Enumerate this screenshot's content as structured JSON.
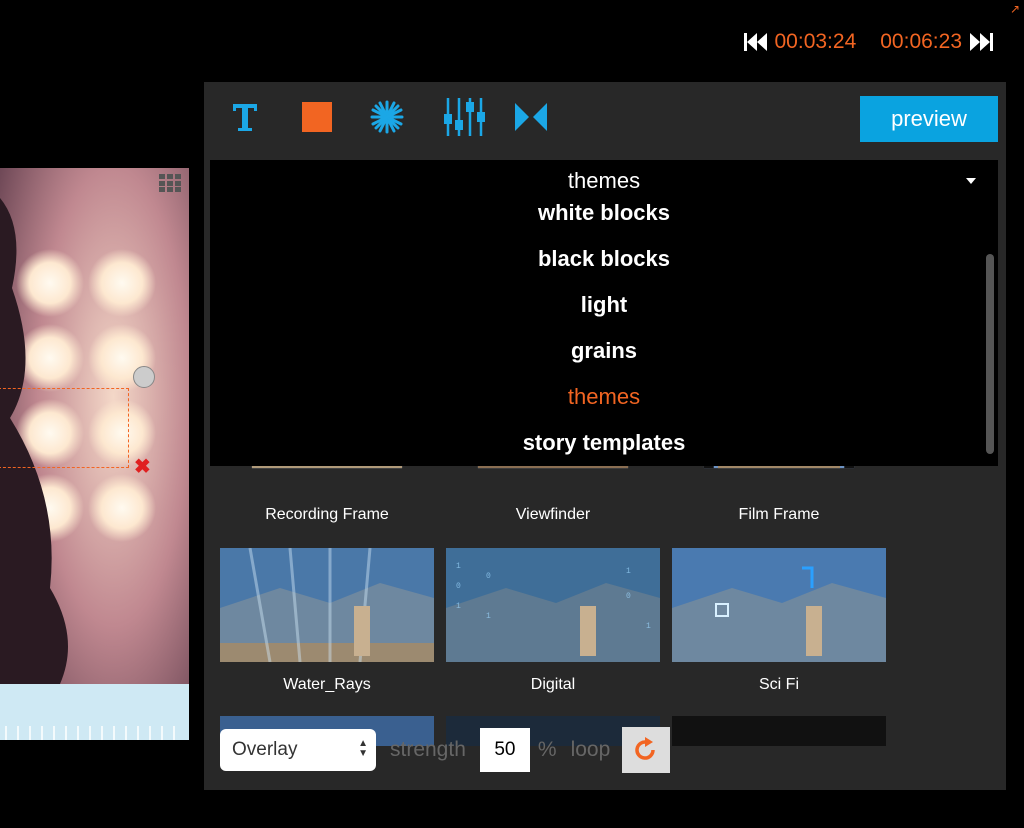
{
  "header": {
    "current_time": "00:03:24",
    "total_time": "00:06:23"
  },
  "toolbar": {
    "tools": [
      "text-tool",
      "shape-tool",
      "effects-tool",
      "adjust-tool",
      "transitions-tool"
    ],
    "preview_label": "preview"
  },
  "dropdown": {
    "selected": "themes",
    "items": [
      "white blocks",
      "black blocks",
      "light",
      "grains",
      "themes",
      "story templates"
    ],
    "active_index": 4
  },
  "thumbnails": [
    {
      "caption": "Recording Frame"
    },
    {
      "caption": "Viewfinder"
    },
    {
      "caption": "Film Frame"
    },
    {
      "caption": "Water_Rays"
    },
    {
      "caption": "Digital"
    },
    {
      "caption": "Sci Fi"
    }
  ],
  "controls": {
    "blend_mode": "Overlay",
    "strength_label": "strength",
    "strength_value": "50",
    "percent_label": "%",
    "loop_label": "loop"
  },
  "colors": {
    "accent": "#f26522",
    "primary": "#0aa3e0",
    "panel": "#282828"
  }
}
